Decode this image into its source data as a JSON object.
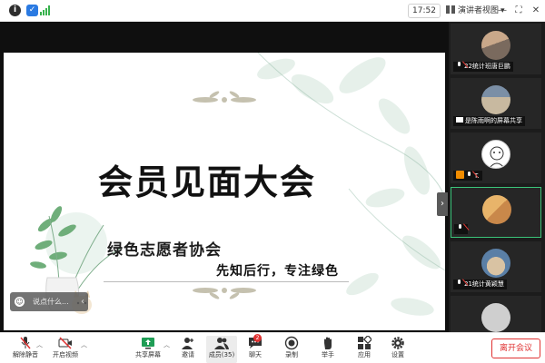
{
  "status_bar": {
    "time": "17:52",
    "view_mode_label": "演讲者视图",
    "icons": [
      "info-icon",
      "shield-icon",
      "signal-icon",
      "grid-icon",
      "minimize-icon",
      "fullscreen-icon",
      "close-icon"
    ]
  },
  "slide": {
    "title": "会员见面大会",
    "subtitle": "绿色志愿者协会",
    "tagline": "先知后行，专注绿色"
  },
  "chat_hint": {
    "placeholder": "说点什么..."
  },
  "participants": [
    {
      "label": "22统计班唐巨鹏",
      "status": "muted"
    },
    {
      "label": "是陈雨啊的屏幕共享",
      "status": "screen-share"
    },
    {
      "label": "T.",
      "status": "muted-host"
    },
    {
      "label": "",
      "status": "speaking"
    },
    {
      "label": "21统计黄颖慧",
      "status": "muted"
    },
    {
      "label": "",
      "status": "muted"
    }
  ],
  "toolbar": {
    "unmute": "解除静音",
    "start_video": "开启视频",
    "share_screen": "共享屏幕",
    "invite": "邀请",
    "members": "成员(35)",
    "chat": "聊天",
    "chat_badge": "2",
    "record": "录制",
    "raise_hand": "举手",
    "apps": "应用",
    "settings": "设置",
    "leave": "离开会议"
  },
  "colors": {
    "accent_green": "#3bc47a",
    "leave_red": "#e03131",
    "signal_green": "#37b24d",
    "shield_blue": "#2a7ae2"
  }
}
